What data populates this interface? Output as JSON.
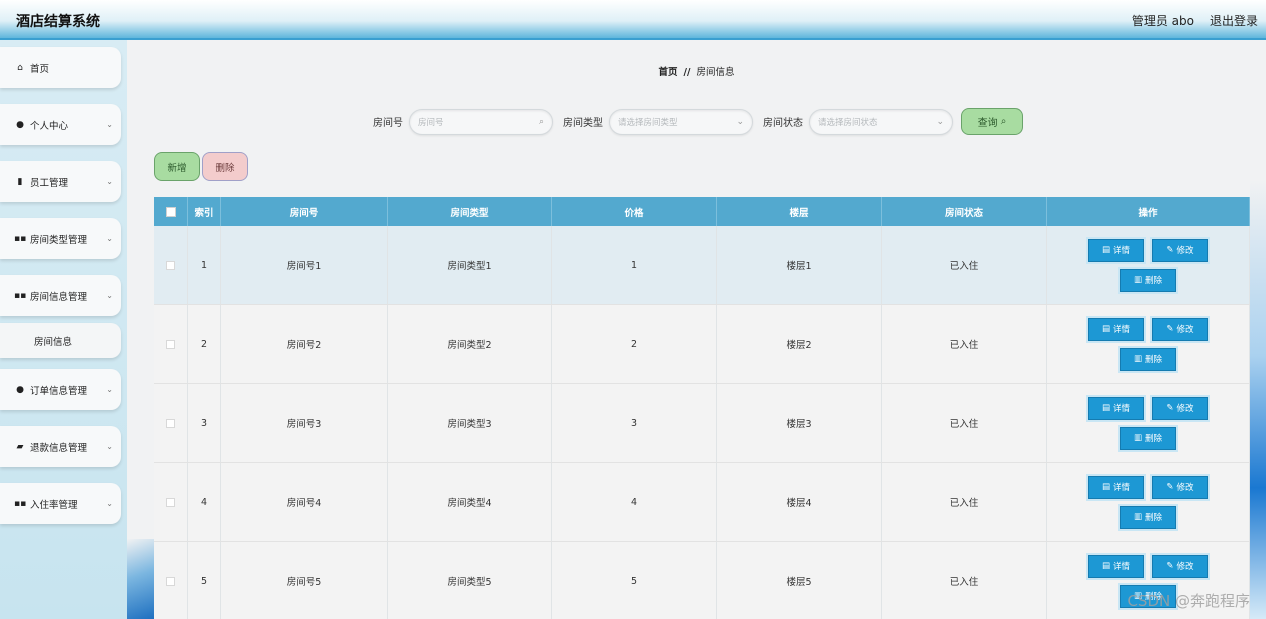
{
  "header": {
    "title": "酒店结算系统",
    "user": "管理员 abo",
    "logout": "退出登录"
  },
  "sidebar": {
    "items": [
      {
        "label": "首页",
        "icon": "home-icon"
      },
      {
        "label": "个人中心",
        "icon": "user-icon"
      },
      {
        "label": "员工管理",
        "icon": "badge-icon"
      },
      {
        "label": "房间类型管理",
        "icon": "grid-icon"
      },
      {
        "label": "房间信息管理",
        "icon": "grid-icon"
      },
      {
        "label": "房间信息",
        "icon": ""
      },
      {
        "label": "订单信息管理",
        "icon": "location-icon"
      },
      {
        "label": "退款信息管理",
        "icon": "thumbs-icon"
      },
      {
        "label": "入住率管理",
        "icon": "grid-icon"
      }
    ]
  },
  "breadcrumb": {
    "home": "首页",
    "sep": "//",
    "current": "房间信息"
  },
  "search": {
    "room_no_label": "房间号",
    "room_no_placeholder": "房间号",
    "room_type_label": "房间类型",
    "room_type_placeholder": "请选择房间类型",
    "room_status_label": "房间状态",
    "room_status_placeholder": "请选择房间状态",
    "query_label": "查询"
  },
  "actions": {
    "add": "新增",
    "delete": "删除"
  },
  "table": {
    "headers": [
      "索引",
      "房间号",
      "房间类型",
      "价格",
      "楼层",
      "房间状态",
      "操作"
    ],
    "rows": [
      {
        "index": "1",
        "room_no": "房间号1",
        "room_type": "房间类型1",
        "price": "1",
        "floor": "楼层1",
        "status": "已入住"
      },
      {
        "index": "2",
        "room_no": "房间号2",
        "room_type": "房间类型2",
        "price": "2",
        "floor": "楼层2",
        "status": "已入住"
      },
      {
        "index": "3",
        "room_no": "房间号3",
        "room_type": "房间类型3",
        "price": "3",
        "floor": "楼层3",
        "status": "已入住"
      },
      {
        "index": "4",
        "room_no": "房间号4",
        "room_type": "房间类型4",
        "price": "4",
        "floor": "楼层4",
        "status": "已入住"
      },
      {
        "index": "5",
        "room_no": "房间号5",
        "room_type": "房间类型5",
        "price": "5",
        "floor": "楼层5",
        "status": "已入住"
      }
    ],
    "ops": {
      "detail": "详情",
      "edit": "修改",
      "delete": "删除"
    }
  },
  "watermark": "CSDN @奔跑程序"
}
